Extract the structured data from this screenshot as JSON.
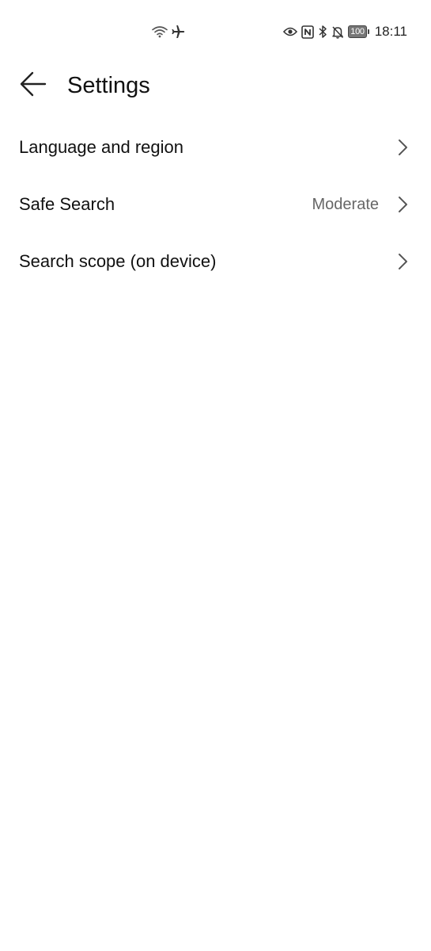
{
  "status_bar": {
    "icons_left": [
      "wifi-icon",
      "airplane-mode-icon"
    ],
    "icons_right": [
      "eye-comfort-icon",
      "nfc-icon",
      "bluetooth-icon",
      "notifications-muted-icon"
    ],
    "battery_level": "100",
    "time": "18:11"
  },
  "header": {
    "back_icon": "back-arrow-icon",
    "title": "Settings"
  },
  "settings": {
    "items": [
      {
        "label": "Language and region",
        "value": ""
      },
      {
        "label": "Safe Search",
        "value": "Moderate"
      },
      {
        "label": "Search scope (on device)",
        "value": ""
      }
    ],
    "chevron_icon": "chevron-right-icon"
  }
}
